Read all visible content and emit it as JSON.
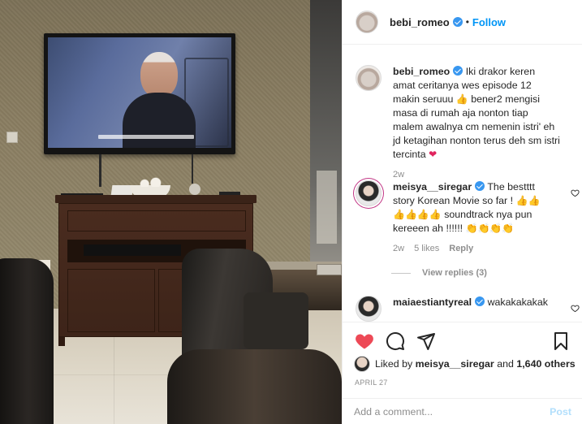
{
  "header": {
    "username": "bebi_romeo",
    "separator": "•",
    "follow_label": "Follow"
  },
  "caption": {
    "username": "bebi_romeo",
    "text_pre": "Iki drakor keren amat ceritanya wes episode 12 makin seruuu ",
    "emoji_1": "👍",
    "text_mid": " bener2 mengisi masa di rumah aja nonton tiap malem awalnya cm nemenin istri' eh jd ketagihan nonton terus deh sm istri tercinta ",
    "emoji_2": "❤",
    "age": "2w"
  },
  "comments": [
    {
      "username": "meisya__siregar",
      "text_pre": "The bestttt story Korean Movie so far ! ",
      "emojis_a": "👍👍👍👍👍👍",
      "text_mid": " soundtrack nya pun kereeen ah !!!!!! ",
      "emojis_b": "👏👏👏👏",
      "age": "2w",
      "likes": "5 likes",
      "reply_label": "Reply",
      "view_replies": "View replies (3)"
    },
    {
      "username": "maiaestiantyreal",
      "text": "wakakakakak"
    }
  ],
  "likes": {
    "prefix": "Liked by",
    "user": "meisya__siregar",
    "suffix": "and",
    "others": "1,640 others"
  },
  "date": "APRIL 27",
  "add_comment": {
    "placeholder": "Add a comment...",
    "post_label": "Post"
  },
  "icons": {
    "like": "heart-filled-icon",
    "comment": "comment-bubble-icon",
    "share": "paper-plane-icon",
    "save": "bookmark-icon",
    "verified": "verified-badge-icon",
    "comment_like": "heart-outline-icon"
  },
  "colors": {
    "accent": "#0095f6",
    "verified": "#3897f0",
    "like": "#ed4956",
    "muted": "#8e8e8e",
    "post_disabled": "#b2dffc"
  }
}
